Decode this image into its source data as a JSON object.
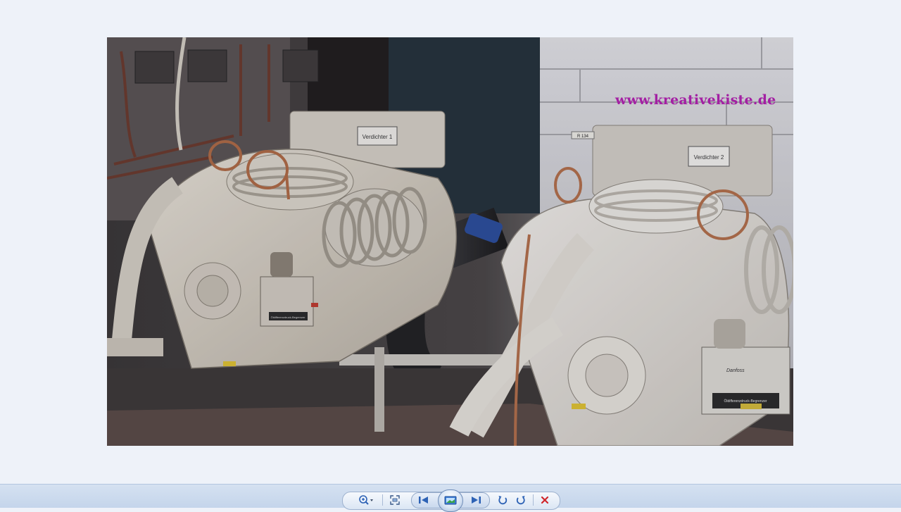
{
  "photo": {
    "watermark": "www.kreativekiste.de",
    "label_left_compressor": "Verdichter 1",
    "label_right_compressor": "Verdichter 2",
    "refrigerant_tag": "R 134",
    "switch_label_left": "Öldifferenzdruck-Begrenzer",
    "switch_label_right": "Öldifferenzdruck-Begrenzer",
    "switch_brand": "Danfoss"
  },
  "toolbar": {
    "zoom_icon": "magnifier-zoom-icon",
    "fit_icon": "actual-size-icon",
    "prev_icon": "previous-icon",
    "slideshow_icon": "slideshow-icon",
    "next_icon": "next-icon",
    "rotate_ccw_icon": "rotate-counterclockwise-icon",
    "rotate_cw_icon": "rotate-clockwise-icon",
    "delete_icon": "delete-icon",
    "colors": {
      "delete": "#d0262b",
      "accent": "#2d62b5"
    }
  }
}
